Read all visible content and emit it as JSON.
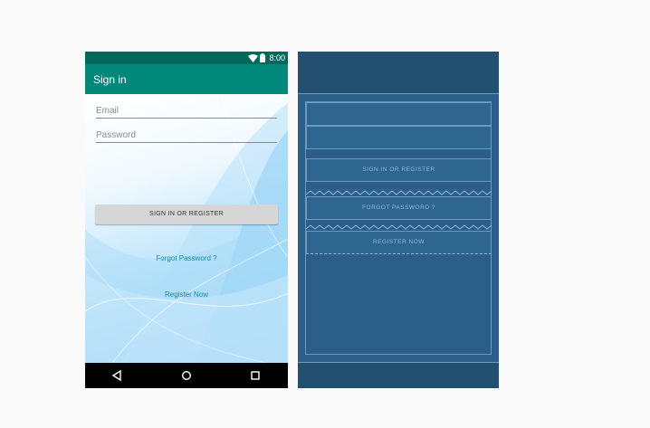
{
  "status_bar": {
    "time": "8:00",
    "icons": [
      "wifi-icon",
      "battery-icon"
    ]
  },
  "app_bar": {
    "title": "Sign in"
  },
  "form": {
    "email_placeholder": "Email",
    "password_placeholder": "Password",
    "signin_label": "SIGN IN OR REGISTER",
    "forgot_label": "Forgot Password ?",
    "register_label": "Register Now"
  },
  "nav_bar": {
    "icons": [
      "back-triangle-icon",
      "home-circle-icon",
      "recents-square-icon"
    ]
  },
  "blueprint": {
    "signin_label": "SIGN IN OR REGISTER",
    "forgot_label": "FORGOT PASSWORD ?",
    "register_label": "REGISTER NOW"
  },
  "colors": {
    "status_bar": "#00695c",
    "app_bar": "#00897b",
    "blueprint_bg": "#2b5f8a",
    "link": "#1a8a9e"
  }
}
